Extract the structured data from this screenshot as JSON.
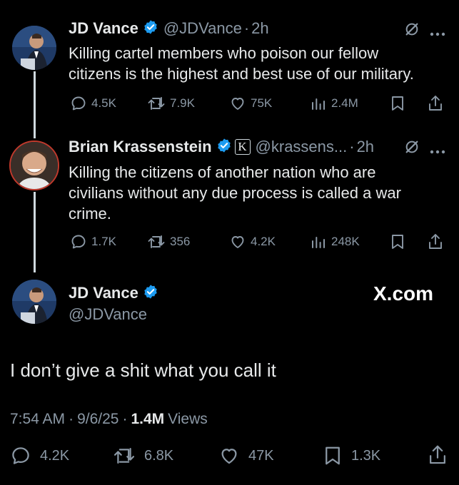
{
  "tweet1": {
    "name": "JD Vance",
    "handle": "@JDVance",
    "dot": "·",
    "time": "2h",
    "text_line1": "Killing cartel members who poison our fellow",
    "text_line2": "citizens is the highest and best use of our military.",
    "replies": "4.5K",
    "reposts": "7.9K",
    "likes": "75K",
    "views": "2.4M"
  },
  "tweet2": {
    "name": "Brian Krassenstein",
    "affiliate_letter": "K",
    "handle": "@krassens...",
    "dot": "·",
    "time": "2h",
    "text_line1": "Killing the citizens of another nation who are",
    "text_line2": "civilians without any due process is called a war",
    "text_line3": "crime.",
    "replies": "1.7K",
    "reposts": "356",
    "likes": "4.2K",
    "views": "248K"
  },
  "main": {
    "name": "JD Vance",
    "handle": "@JDVance",
    "brand": "X.com",
    "text": "I don’t give a shit what you call it",
    "time": "7:54 AM",
    "date": "9/6/25",
    "views_count": "1.4M",
    "views_label": "Views",
    "dot": "·",
    "replies": "4.2K",
    "reposts": "6.8K",
    "likes": "47K",
    "bookmarks": "1.3K"
  },
  "colors": {
    "background": "#000000",
    "text": "#e7e9ea",
    "muted": "#8b98a5",
    "verified": "#1d9bf0"
  }
}
